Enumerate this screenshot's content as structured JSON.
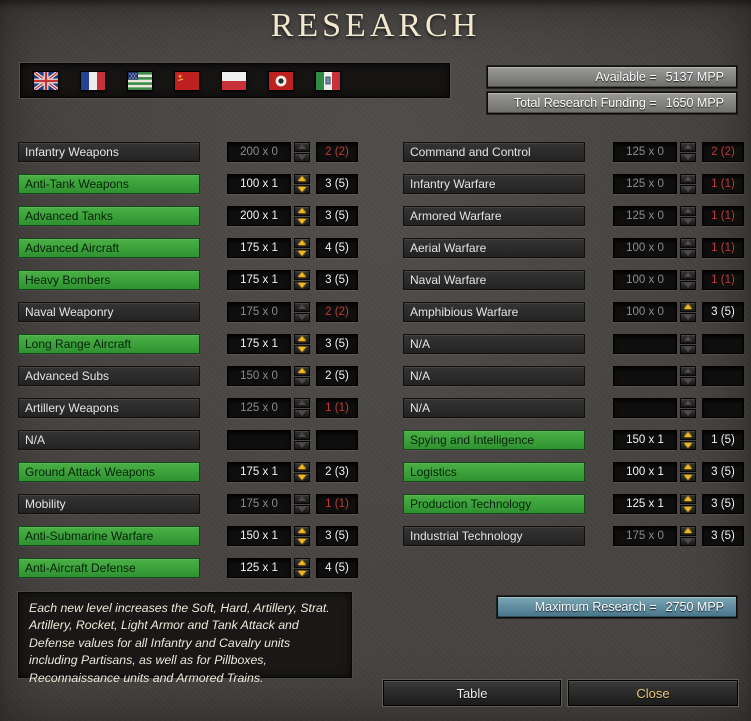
{
  "title": "RESEARCH",
  "header": {
    "flags": [
      "uk",
      "france",
      "usa",
      "ussr",
      "poland",
      "china",
      "italy"
    ],
    "available_label": "Available =",
    "available_value": "5137 MPP",
    "funding_label": "Total Research Funding =",
    "funding_value": "1650 MPP"
  },
  "research": {
    "left": [
      {
        "label": "Infantry Weapons",
        "green": false,
        "cost": "200 x 0",
        "cost_dim": true,
        "level": "2 (2)",
        "level_max": true,
        "up": false,
        "down": false
      },
      {
        "label": "Anti-Tank Weapons",
        "green": true,
        "cost": "100 x 1",
        "cost_dim": false,
        "level": "3 (5)",
        "level_max": false,
        "up": true,
        "down": true
      },
      {
        "label": "Advanced Tanks",
        "green": true,
        "cost": "200 x 1",
        "cost_dim": false,
        "level": "3 (5)",
        "level_max": false,
        "up": true,
        "down": true
      },
      {
        "label": "Advanced Aircraft",
        "green": true,
        "cost": "175 x 1",
        "cost_dim": false,
        "level": "4 (5)",
        "level_max": false,
        "up": true,
        "down": true
      },
      {
        "label": "Heavy Bombers",
        "green": true,
        "cost": "175 x 1",
        "cost_dim": false,
        "level": "3 (5)",
        "level_max": false,
        "up": true,
        "down": true
      },
      {
        "label": "Naval Weaponry",
        "green": false,
        "cost": "175 x 0",
        "cost_dim": true,
        "level": "2 (2)",
        "level_max": true,
        "up": false,
        "down": false
      },
      {
        "label": "Long Range Aircraft",
        "green": true,
        "cost": "175 x 1",
        "cost_dim": false,
        "level": "3 (5)",
        "level_max": false,
        "up": true,
        "down": true
      },
      {
        "label": "Advanced Subs",
        "green": false,
        "cost": "150 x 0",
        "cost_dim": true,
        "level": "2 (5)",
        "level_max": false,
        "up": true,
        "down": false
      },
      {
        "label": "Artillery Weapons",
        "green": false,
        "cost": "125 x 0",
        "cost_dim": true,
        "level": "1 (1)",
        "level_max": true,
        "up": false,
        "down": false
      },
      {
        "label": "N/A",
        "green": false,
        "cost": "",
        "cost_dim": true,
        "level": "",
        "level_max": false,
        "up": false,
        "down": false
      },
      {
        "label": "Ground Attack Weapons",
        "green": true,
        "cost": "175 x 1",
        "cost_dim": false,
        "level": "2 (3)",
        "level_max": false,
        "up": true,
        "down": true
      },
      {
        "label": "Mobility",
        "green": false,
        "cost": "175 x 0",
        "cost_dim": true,
        "level": "1 (1)",
        "level_max": true,
        "up": false,
        "down": false
      },
      {
        "label": "Anti-Submarine Warfare",
        "green": true,
        "cost": "150 x 1",
        "cost_dim": false,
        "level": "3 (5)",
        "level_max": false,
        "up": true,
        "down": true
      },
      {
        "label": "Anti-Aircraft Defense",
        "green": true,
        "cost": "125 x 1",
        "cost_dim": false,
        "level": "4 (5)",
        "level_max": false,
        "up": true,
        "down": true
      }
    ],
    "right": [
      {
        "label": "Command and Control",
        "green": false,
        "cost": "125 x 0",
        "cost_dim": true,
        "level": "2 (2)",
        "level_max": true,
        "up": false,
        "down": false
      },
      {
        "label": "Infantry Warfare",
        "green": false,
        "cost": "125 x 0",
        "cost_dim": true,
        "level": "1 (1)",
        "level_max": true,
        "up": false,
        "down": false
      },
      {
        "label": "Armored Warfare",
        "green": false,
        "cost": "125 x 0",
        "cost_dim": true,
        "level": "1 (1)",
        "level_max": true,
        "up": false,
        "down": false
      },
      {
        "label": "Aerial Warfare",
        "green": false,
        "cost": "100 x 0",
        "cost_dim": true,
        "level": "1 (1)",
        "level_max": true,
        "up": false,
        "down": false
      },
      {
        "label": "Naval Warfare",
        "green": false,
        "cost": "100 x 0",
        "cost_dim": true,
        "level": "1 (1)",
        "level_max": true,
        "up": false,
        "down": false
      },
      {
        "label": "Amphibious Warfare",
        "green": false,
        "cost": "100 x 0",
        "cost_dim": true,
        "level": "3 (5)",
        "level_max": false,
        "up": true,
        "down": false
      },
      {
        "label": "N/A",
        "green": false,
        "cost": "",
        "cost_dim": true,
        "level": "",
        "level_max": false,
        "up": false,
        "down": false
      },
      {
        "label": "N/A",
        "green": false,
        "cost": "",
        "cost_dim": true,
        "level": "",
        "level_max": false,
        "up": false,
        "down": false
      },
      {
        "label": "N/A",
        "green": false,
        "cost": "",
        "cost_dim": true,
        "level": "",
        "level_max": false,
        "up": false,
        "down": false
      },
      {
        "label": "Spying and Intelligence",
        "green": true,
        "cost": "150 x 1",
        "cost_dim": false,
        "level": "1 (5)",
        "level_max": false,
        "up": true,
        "down": true
      },
      {
        "label": "Logistics",
        "green": true,
        "cost": "100 x 1",
        "cost_dim": false,
        "level": "3 (5)",
        "level_max": false,
        "up": true,
        "down": true
      },
      {
        "label": "Production Technology",
        "green": true,
        "cost": "125 x 1",
        "cost_dim": false,
        "level": "3 (5)",
        "level_max": false,
        "up": true,
        "down": true
      },
      {
        "label": "Industrial Technology",
        "green": false,
        "cost": "175 x 0",
        "cost_dim": true,
        "level": "3 (5)",
        "level_max": false,
        "up": true,
        "down": false
      }
    ]
  },
  "description": "Each new level increases the Soft, Hard, Artillery, Strat. Artillery, Rocket, Light Armor and Tank Attack and Defense values for all Infantry and Cavalry units including Partisans, as well as for Pillboxes, Reconnaissance units and Armored Trains.",
  "footer": {
    "maximum_label": "Maximum Research =",
    "maximum_value": "2750 MPP",
    "table_button": "Table",
    "close_button": "Close"
  },
  "colors": {
    "highlight_green": "#3aa23c",
    "maxed_red": "#bc3a33",
    "arrow_active": "#efb41e",
    "maximum_bar_teal": "#5d8fa0"
  }
}
